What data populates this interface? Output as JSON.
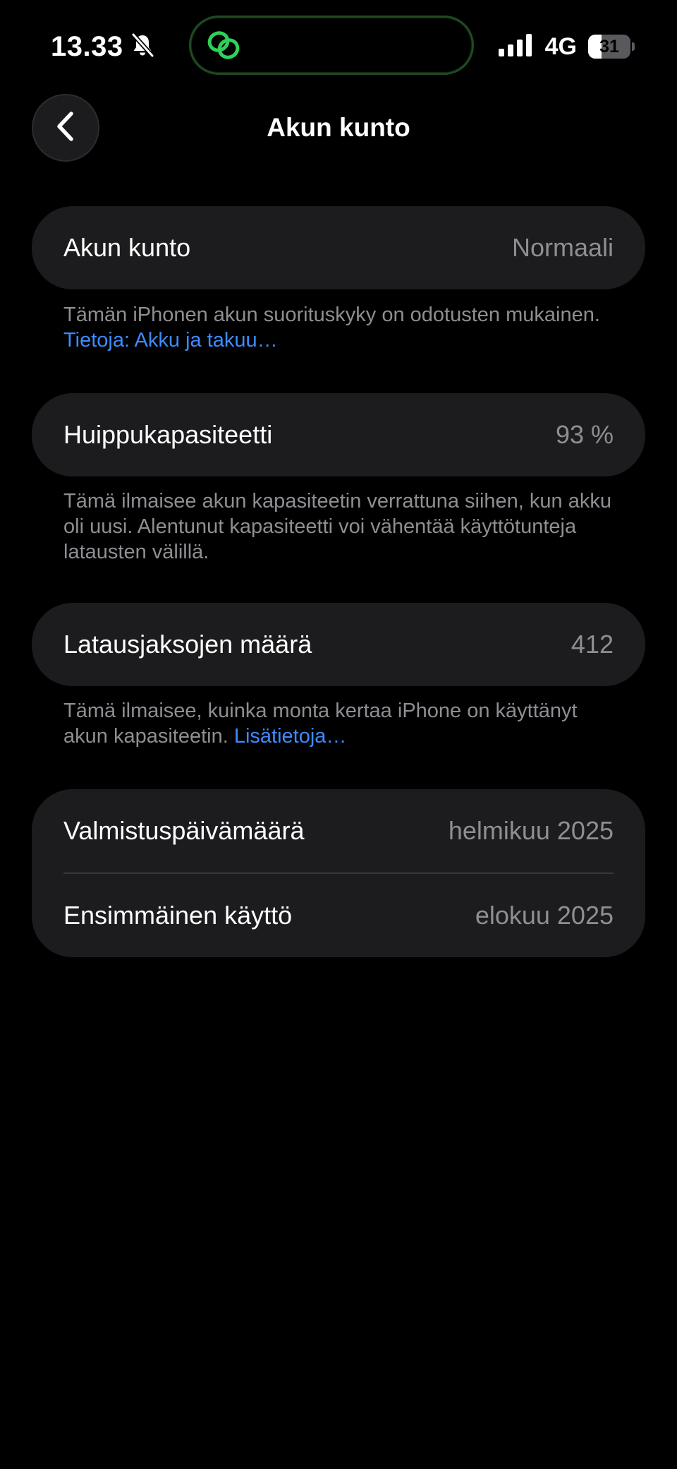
{
  "status_bar": {
    "time": "13.33",
    "network": "4G",
    "battery_level": "31",
    "battery_fraction": 0.31,
    "icons": [
      "bell-slash-icon",
      "app-link-icon",
      "cellular-signal-icon",
      "battery-icon"
    ]
  },
  "nav": {
    "back_icon": "chevron-left-icon",
    "title": "Akun kunto"
  },
  "sections": {
    "health": {
      "label": "Akun kunto",
      "value": "Normaali",
      "note": "Tämän iPhonen akun suorituskyky on odotusten mukainen.",
      "note_link": "Tietoja: Akku ja takuu…"
    },
    "capacity": {
      "label": "Huippukapasiteetti",
      "value": "93 %",
      "note": "Tämä ilmaisee akun kapasiteetin verrattuna siihen, kun akku oli uusi. Alentunut kapasiteetti voi vähentää käyttötunteja latausten välillä."
    },
    "cycles": {
      "label": "Latausjaksojen määrä",
      "value": "412",
      "note": "Tämä ilmaisee, kuinka monta kertaa iPhone on käyttänyt akun kapasiteetin.",
      "note_link": "Lisätietoja…"
    },
    "dates": {
      "manufacture_label": "Valmistuspäivämäärä",
      "manufacture_value": "helmikuu 2025",
      "first_use_label": "Ensimmäinen käyttö",
      "first_use_value": "elokuu 2025"
    }
  },
  "colors": {
    "background": "#000000",
    "card": "#1c1c1e",
    "secondary_text": "#8e8e93",
    "link": "#3e8bff",
    "island_accent": "#30d158"
  }
}
